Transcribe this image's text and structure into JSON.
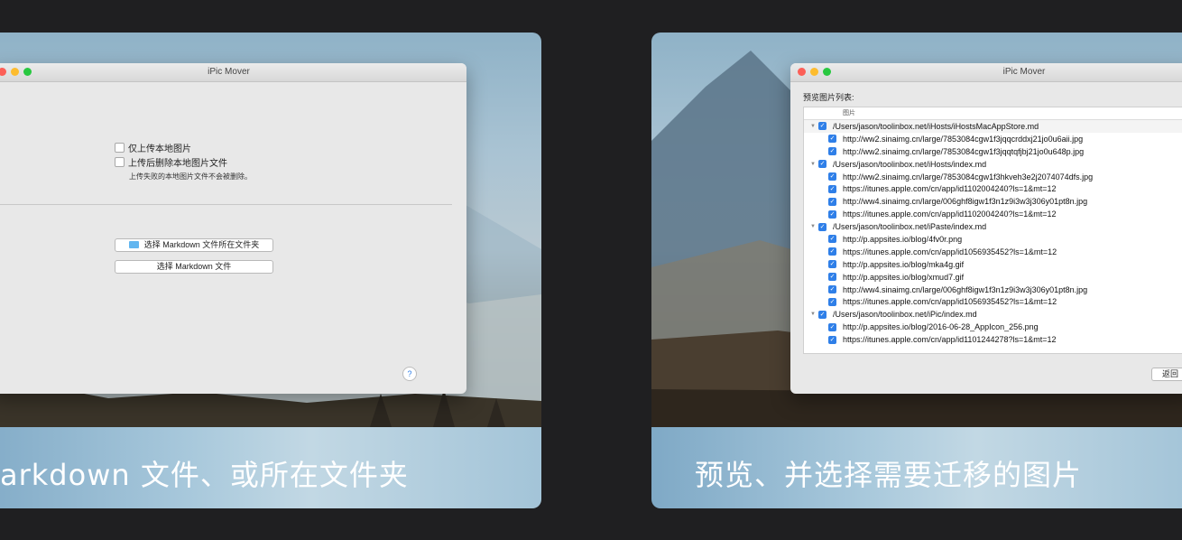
{
  "left_card": {
    "banner_text": "arkdown 文件、或所在文件夹",
    "window": {
      "title": "iPic Mover",
      "checkbox_upload_local_only": "仅上传本地图片",
      "checkbox_delete_after_upload": "上传后删除本地图片文件",
      "delete_note": "上传失败的本地图片文件不会被删除。",
      "select_folder_button": "选择 Markdown 文件所在文件夹",
      "select_file_button": "选择 Markdown 文件",
      "help_label": "?"
    }
  },
  "right_card": {
    "banner_text": "预览、并选择需要迁移的图片",
    "window": {
      "title": "iPic Mover",
      "list_label": "预览图片列表:",
      "column_header": "图片",
      "back_button": "返回",
      "rows": [
        {
          "type": "group",
          "text": "/Users/jason/toolinbox.net/iHosts/iHostsMacAppStore.md"
        },
        {
          "type": "child",
          "text": "http://ww2.sinaimg.cn/large/7853084cgw1f3jqqcrddxj21jo0u6aii.jpg"
        },
        {
          "type": "child",
          "text": "http://ww2.sinaimg.cn/large/7853084cgw1f3jqqtqfjbj21jo0u648p.jpg"
        },
        {
          "type": "group",
          "text": "/Users/jason/toolinbox.net/iHosts/index.md"
        },
        {
          "type": "child",
          "text": "http://ww2.sinaimg.cn/large/7853084cgw1f3hkveh3e2j2074074dfs.jpg"
        },
        {
          "type": "child",
          "text": "https://itunes.apple.com/cn/app/id1102004240?ls=1&mt=12"
        },
        {
          "type": "child",
          "text": "http://ww4.sinaimg.cn/large/006ghf8igw1f3n1z9i3w3j306y01pt8n.jpg"
        },
        {
          "type": "child",
          "text": "https://itunes.apple.com/cn/app/id1102004240?ls=1&mt=12"
        },
        {
          "type": "group",
          "text": "/Users/jason/toolinbox.net/iPaste/index.md"
        },
        {
          "type": "child",
          "text": "http://p.appsites.io/blog/4fv0r.png"
        },
        {
          "type": "child",
          "text": "https://itunes.apple.com/cn/app/id1056935452?ls=1&mt=12"
        },
        {
          "type": "child",
          "text": "http://p.appsites.io/blog/mka4g.gif"
        },
        {
          "type": "child",
          "text": "http://p.appsites.io/blog/xmud7.gif"
        },
        {
          "type": "child",
          "text": "http://ww4.sinaimg.cn/large/006ghf8igw1f3n1z9i3w3j306y01pt8n.jpg"
        },
        {
          "type": "child",
          "text": "https://itunes.apple.com/cn/app/id1056935452?ls=1&mt=12"
        },
        {
          "type": "group",
          "text": "/Users/jason/toolinbox.net/iPic/index.md"
        },
        {
          "type": "child",
          "text": "http://p.appsites.io/blog/2016-06-28_AppIcon_256.png"
        },
        {
          "type": "child",
          "text": "https://itunes.apple.com/cn/app/id1101244278?ls=1&mt=12"
        }
      ]
    }
  },
  "colors": {
    "background": "#1f1f21",
    "checkbox_accent": "#2f7fe8",
    "folder_icon": "#62b6f0"
  }
}
